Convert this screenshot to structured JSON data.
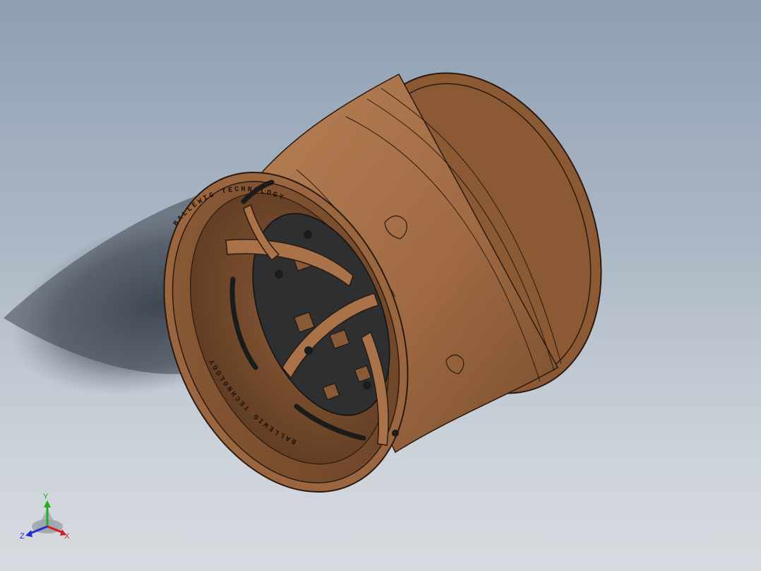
{
  "viewport": {
    "background_top": "#8e9fb4",
    "background_bottom": "#d7dbe0",
    "model": {
      "name": "wheel-rim",
      "color": "#9a6640",
      "highlight": "#b78156",
      "shadow_color": "#4d3320",
      "dark_parts": "#2d2f31",
      "rim_text": "BALLEWIG TECHNOLOGY"
    }
  },
  "triad": {
    "x_label": "X",
    "y_label": "Y",
    "z_label": "Z",
    "x_color": "#d11e1e",
    "y_color": "#1fb11f",
    "z_color": "#1f2fd1"
  }
}
